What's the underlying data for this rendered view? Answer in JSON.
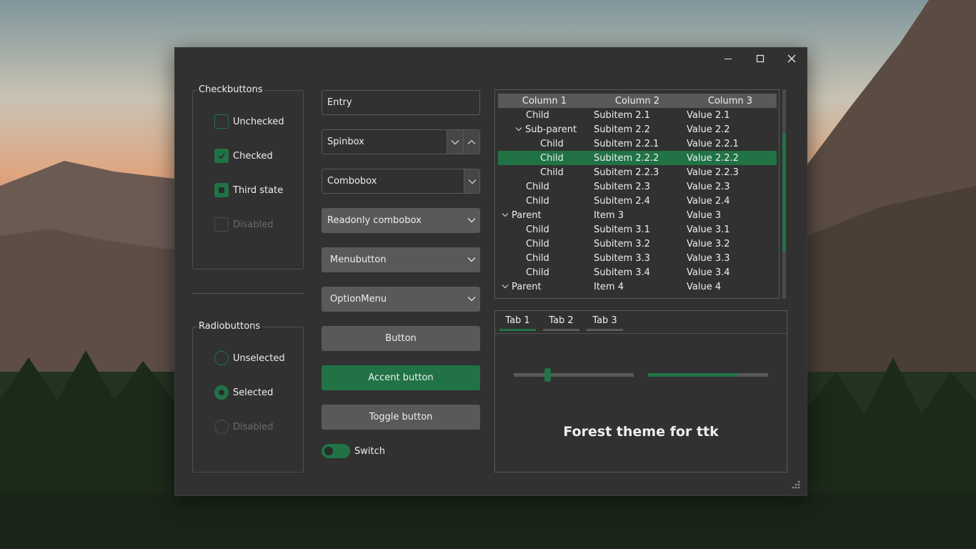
{
  "colors": {
    "accent": "#217346",
    "window_bg": "#313131",
    "field_bg": "#595959",
    "text": "#eeeeee",
    "disabled_text": "#6b6b6b"
  },
  "window": {
    "controls": [
      "minimize-icon",
      "maximize-icon",
      "close-icon"
    ]
  },
  "checkbuttons": {
    "label": "Checkbuttons",
    "items": [
      {
        "label": "Unchecked",
        "state": "unchecked"
      },
      {
        "label": "Checked",
        "state": "checked"
      },
      {
        "label": "Third state",
        "state": "indeterminate"
      },
      {
        "label": "Disabled",
        "state": "disabled"
      }
    ]
  },
  "radiobuttons": {
    "label": "Radiobuttons",
    "items": [
      {
        "label": "Unselected",
        "state": "unselected"
      },
      {
        "label": "Selected",
        "state": "selected"
      },
      {
        "label": "Disabled",
        "state": "disabled"
      }
    ]
  },
  "widgets": {
    "entry": {
      "value": "Entry"
    },
    "spinbox": {
      "value": "Spinbox"
    },
    "combobox": {
      "value": "Combobox"
    },
    "readonly_combobox": {
      "value": "Readonly combobox"
    },
    "menubutton": {
      "label": "Menubutton"
    },
    "optionmenu": {
      "label": "OptionMenu"
    },
    "button": {
      "label": "Button"
    },
    "accent_button": {
      "label": "Accent button"
    },
    "toggle_button": {
      "label": "Toggle button"
    },
    "switch": {
      "label": "Switch",
      "on": true
    }
  },
  "treeview": {
    "columns": [
      "Column 1",
      "Column 2",
      "Column 3"
    ],
    "rows": [
      {
        "c1": "Child",
        "c2": "Subitem 2.1",
        "c3": "Value 2.1",
        "depth": 1,
        "expander": false,
        "selected": false
      },
      {
        "c1": "Sub-parent",
        "c2": "Subitem 2.2",
        "c3": "Value 2.2",
        "depth": 1,
        "expander": true,
        "selected": false
      },
      {
        "c1": "Child",
        "c2": "Subitem 2.2.1",
        "c3": "Value 2.2.1",
        "depth": 2,
        "expander": false,
        "selected": false
      },
      {
        "c1": "Child",
        "c2": "Subitem 2.2.2",
        "c3": "Value 2.2.2",
        "depth": 2,
        "expander": false,
        "selected": true
      },
      {
        "c1": "Child",
        "c2": "Subitem 2.2.3",
        "c3": "Value 2.2.3",
        "depth": 2,
        "expander": false,
        "selected": false
      },
      {
        "c1": "Child",
        "c2": "Subitem 2.3",
        "c3": "Value 2.3",
        "depth": 1,
        "expander": false,
        "selected": false
      },
      {
        "c1": "Child",
        "c2": "Subitem 2.4",
        "c3": "Value 2.4",
        "depth": 1,
        "expander": false,
        "selected": false
      },
      {
        "c1": "Parent",
        "c2": "Item 3",
        "c3": "Value 3",
        "depth": 0,
        "expander": true,
        "selected": false
      },
      {
        "c1": "Child",
        "c2": "Subitem 3.1",
        "c3": "Value 3.1",
        "depth": 1,
        "expander": false,
        "selected": false
      },
      {
        "c1": "Child",
        "c2": "Subitem 3.2",
        "c3": "Value 3.2",
        "depth": 1,
        "expander": false,
        "selected": false
      },
      {
        "c1": "Child",
        "c2": "Subitem 3.3",
        "c3": "Value 3.3",
        "depth": 1,
        "expander": false,
        "selected": false
      },
      {
        "c1": "Child",
        "c2": "Subitem 3.4",
        "c3": "Value 3.4",
        "depth": 1,
        "expander": false,
        "selected": false
      },
      {
        "c1": "Parent",
        "c2": "Item 4",
        "c3": "Value 4",
        "depth": 0,
        "expander": true,
        "selected": false
      }
    ]
  },
  "notebook": {
    "tabs": [
      {
        "label": "Tab 1",
        "active": true
      },
      {
        "label": "Tab 2",
        "active": false
      },
      {
        "label": "Tab 3",
        "active": false
      }
    ],
    "scale_value": 0.27,
    "progress_value": 0.75,
    "label": "Forest theme for ttk"
  }
}
